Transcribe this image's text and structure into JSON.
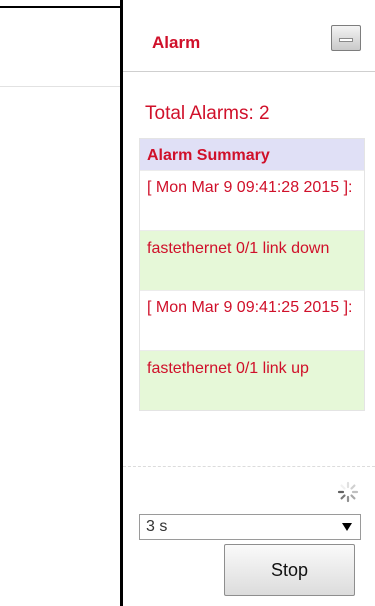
{
  "panel": {
    "title": "Alarm",
    "minimize_icon": "minimize-icon"
  },
  "total_alarms": "Total Alarms: 2",
  "summary": {
    "header": "Alarm Summary",
    "entries": [
      {
        "time": "[ Mon Mar 9 09:41:28 2015 ]:",
        "message": "fastethernet 0/1 link down"
      },
      {
        "time": "[ Mon Mar 9 09:41:25 2015 ]:",
        "message": "fastethernet 0/1 link up"
      }
    ]
  },
  "refresh": {
    "spinner_icon": "loading-spinner-icon",
    "interval_value": "3 s",
    "stop_label": "Stop"
  },
  "colors": {
    "accent_red": "#d0102a",
    "summary_header_bg": "#e0e0f6",
    "message_row_bg": "#e6f8d8"
  }
}
